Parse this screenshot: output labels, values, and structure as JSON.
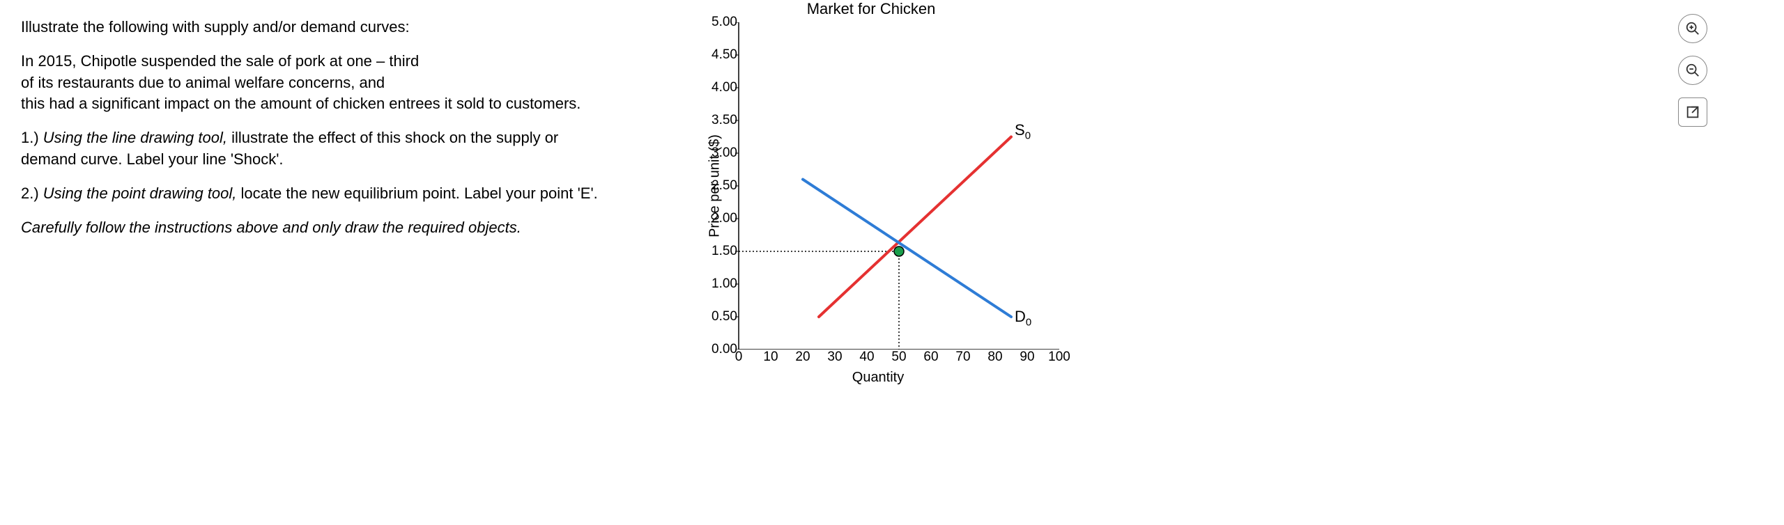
{
  "question": {
    "intro": "Illustrate the following with supply and/or demand curves:",
    "scenario_l1": "In 2015, Chipotle suspended the sale of pork at one – third",
    "scenario_l2": "of its restaurants due to animal welfare concerns, and",
    "scenario_l3": "this had a significant impact on the amount of chicken  entrees it sold to customers.",
    "step1_prefix": "1.) ",
    "step1_italic": "Using the line drawing tool,",
    "step1_rest": " illustrate the effect of this shock on the supply or demand curve. Label your line 'Shock'.",
    "step2_prefix": "2.) ",
    "step2_italic": "Using the point drawing tool,",
    "step2_rest": " locate the new equilibrium point. Label your point 'E'.",
    "caution": "Carefully follow the instructions above and only draw the required objects."
  },
  "chart_data": {
    "type": "line",
    "title": "Market for Chicken",
    "xlabel": "Quantity",
    "ylabel": "Price per unit ($)",
    "xlim": [
      0,
      100
    ],
    "ylim": [
      0,
      5
    ],
    "x_ticks": [
      0,
      10,
      20,
      30,
      40,
      50,
      60,
      70,
      80,
      90,
      100
    ],
    "y_ticks": [
      "0.00",
      "0.50",
      "1.00",
      "1.50",
      "2.00",
      "2.50",
      "3.00",
      "3.50",
      "4.00",
      "4.50",
      "5.00"
    ],
    "series": [
      {
        "name": "S0",
        "color": "#e53131",
        "x": [
          25,
          85
        ],
        "y": [
          0.5,
          3.25
        ]
      },
      {
        "name": "D0",
        "color": "#2e7cd6",
        "x": [
          20,
          85
        ],
        "y": [
          2.6,
          0.5
        ]
      }
    ],
    "equilibrium": {
      "x": 50,
      "y": 1.5,
      "color": "#1a9e4b"
    },
    "guides": [
      {
        "type": "h",
        "y": 1.5,
        "x_from": 0,
        "x_to": 50
      },
      {
        "type": "v",
        "x": 50,
        "y_from": 0,
        "y_to": 1.5
      }
    ],
    "labels": {
      "S0": "S",
      "S0_sub": "0",
      "D0": "D",
      "D0_sub": "0"
    }
  },
  "toolbar": {
    "zoom_in": "zoom-in",
    "zoom_out": "zoom-out",
    "expand": "expand"
  }
}
